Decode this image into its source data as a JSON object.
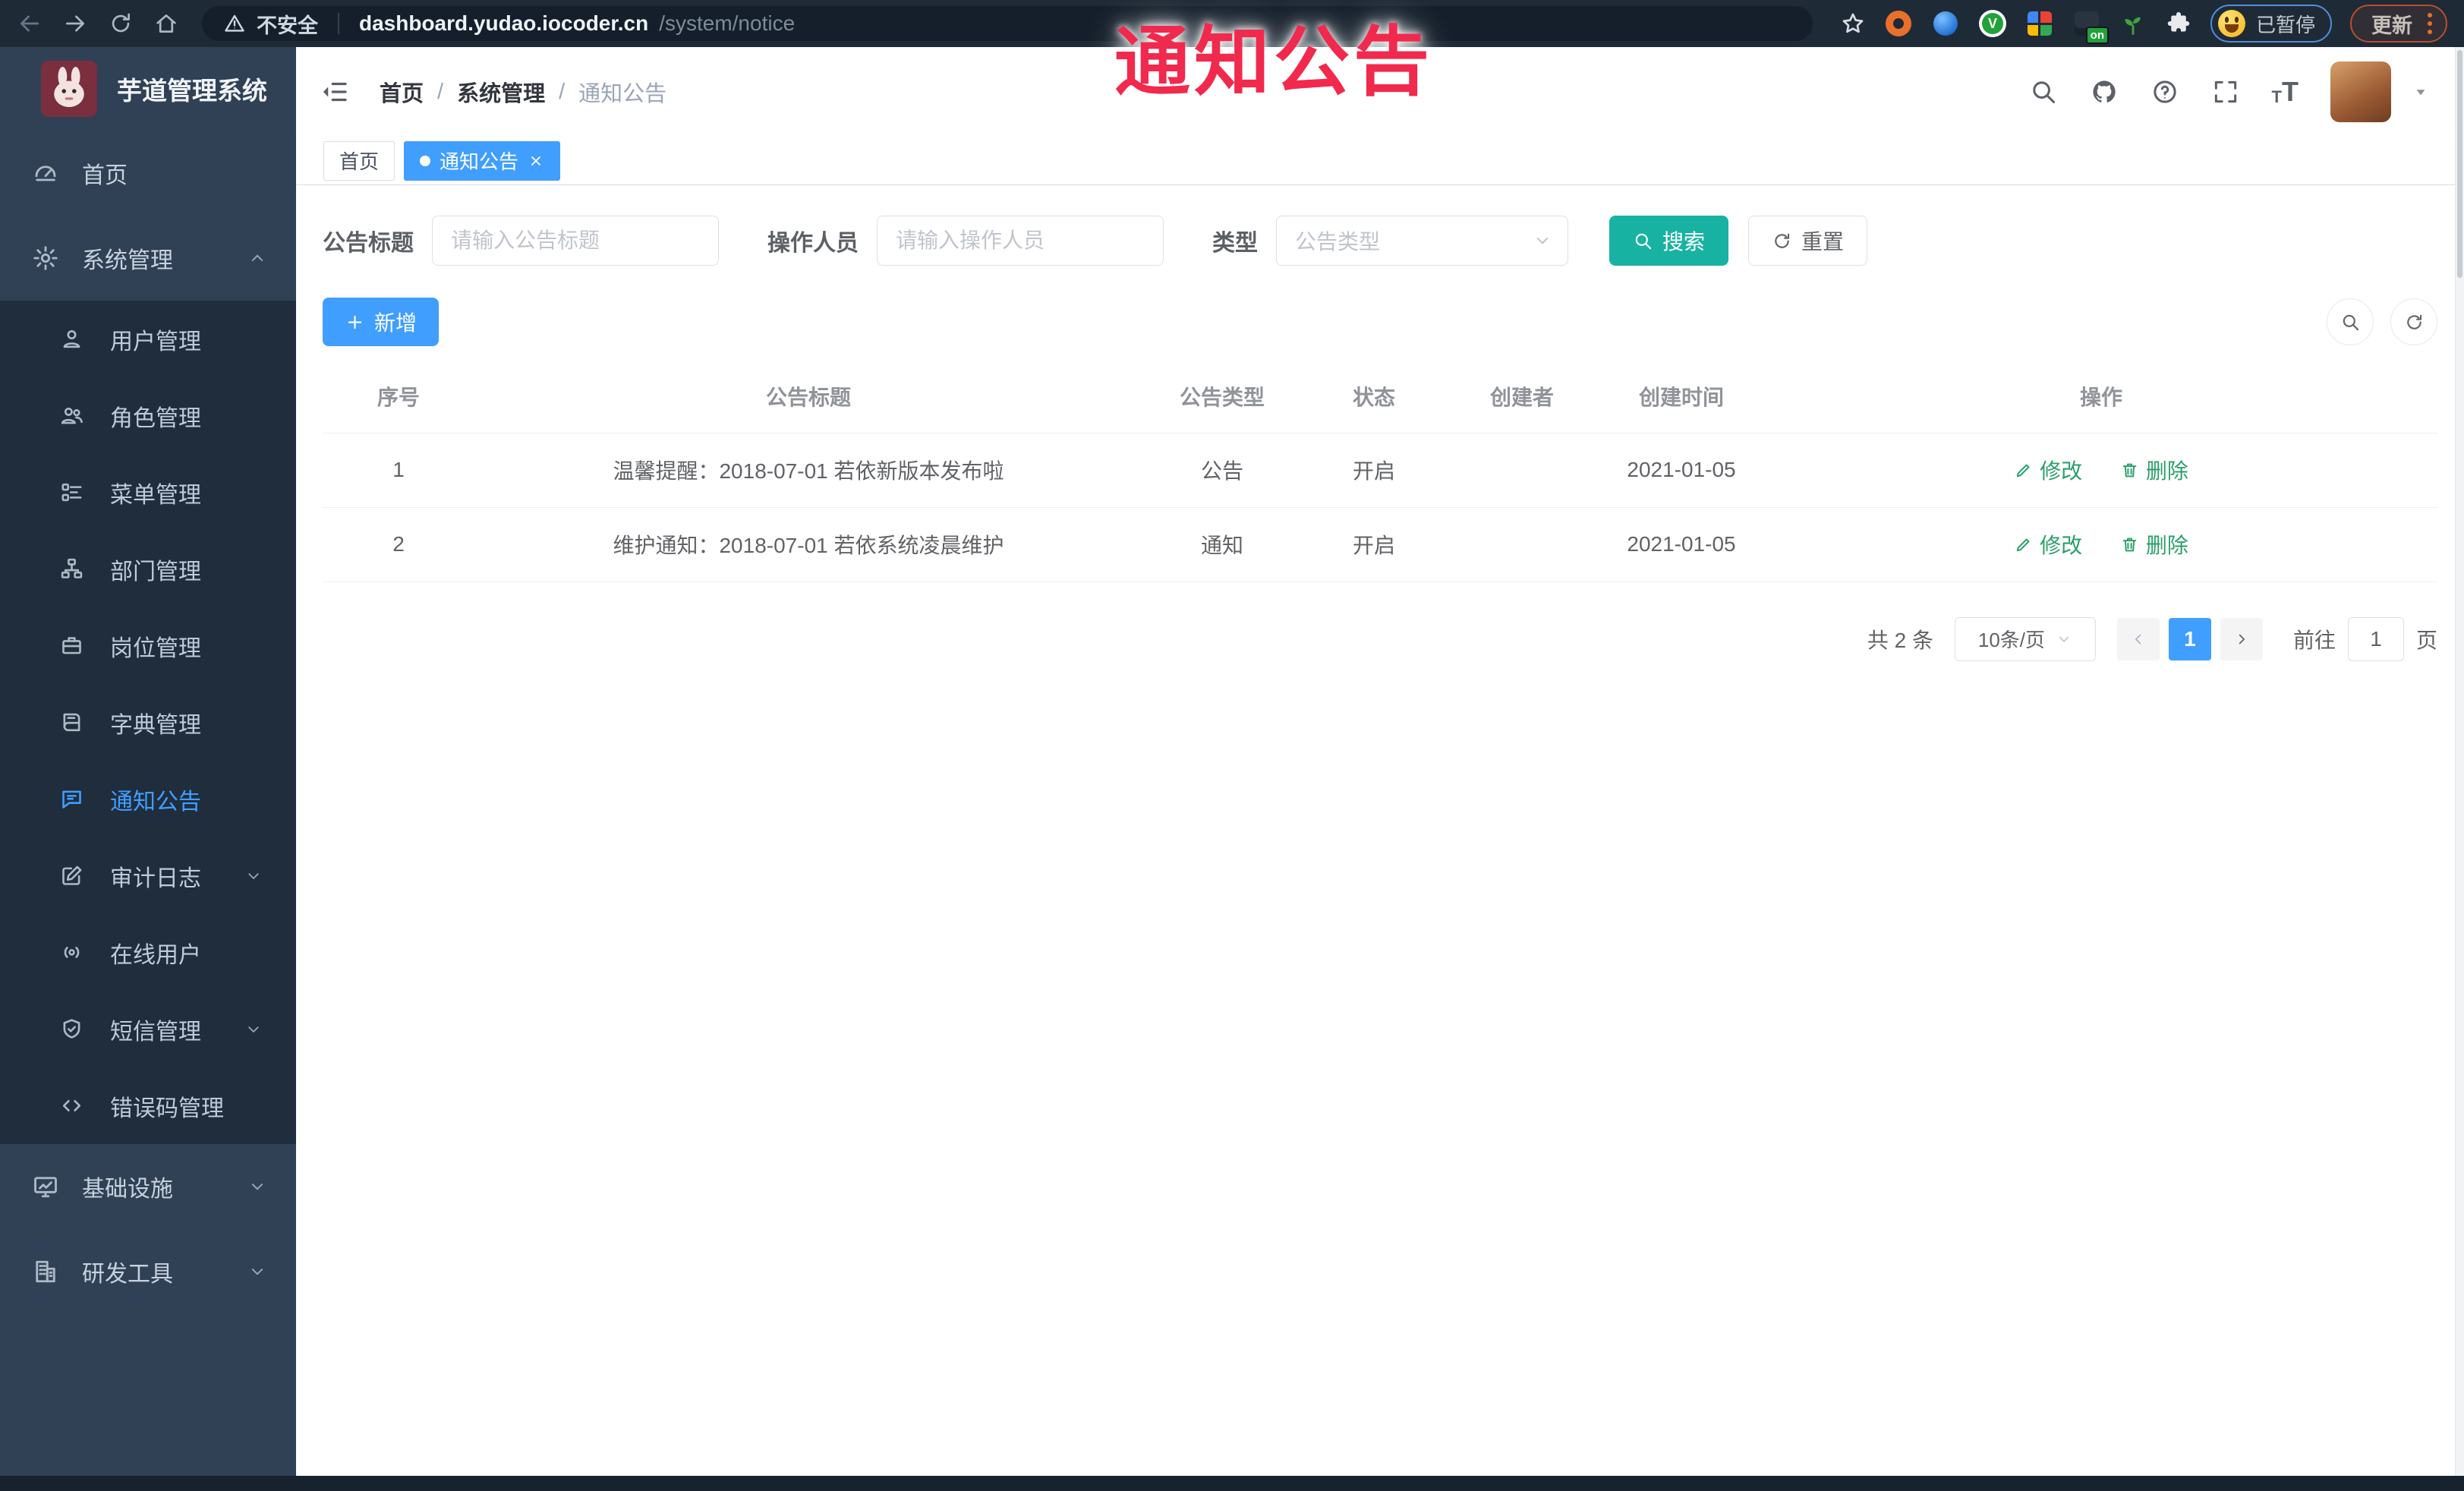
{
  "browser": {
    "security_label": "不安全",
    "url_host": "dashboard.yudao.iocoder.cn",
    "url_path": "/system/notice",
    "extension_badge": "on",
    "extension_v_glyph": "V",
    "profile_label": "已暂停",
    "update_label": "更新"
  },
  "overlay_title": "通知公告",
  "sidebar": {
    "logo_title": "芋道管理系统",
    "items_top": [
      {
        "label": "首页"
      },
      {
        "label": "系统管理"
      }
    ],
    "system_children": [
      {
        "label": "用户管理"
      },
      {
        "label": "角色管理"
      },
      {
        "label": "菜单管理"
      },
      {
        "label": "部门管理"
      },
      {
        "label": "岗位管理"
      },
      {
        "label": "字典管理"
      },
      {
        "label": "通知公告"
      },
      {
        "label": "审计日志"
      },
      {
        "label": "在线用户"
      },
      {
        "label": "短信管理"
      },
      {
        "label": "错误码管理"
      }
    ],
    "items_bottom": [
      {
        "label": "基础设施"
      },
      {
        "label": "研发工具"
      }
    ]
  },
  "header": {
    "breadcrumb": [
      "首页",
      "系统管理",
      "通知公告"
    ],
    "separator": "/",
    "font_icon_small": "T",
    "font_icon_big": "T"
  },
  "tabs": [
    {
      "label": "首页"
    },
    {
      "label": "通知公告"
    }
  ],
  "filters": {
    "title_label": "公告标题",
    "title_placeholder": "请输入公告标题",
    "operator_label": "操作人员",
    "operator_placeholder": "请输入操作人员",
    "type_label": "类型",
    "type_placeholder": "公告类型",
    "search_label": "搜索",
    "reset_label": "重置"
  },
  "toolbar": {
    "add_label": "新增"
  },
  "table": {
    "columns": [
      "序号",
      "公告标题",
      "公告类型",
      "状态",
      "创建者",
      "创建时间",
      "操作"
    ],
    "rows": [
      {
        "no": "1",
        "title": "温馨提醒：2018-07-01 若依新版本发布啦",
        "type": "公告",
        "status": "开启",
        "creator": "",
        "created": "2021-01-05",
        "edit_label": "修改",
        "delete_label": "删除"
      },
      {
        "no": "2",
        "title": "维护通知：2018-07-01 若依系统凌晨维护",
        "type": "通知",
        "status": "开启",
        "creator": "",
        "created": "2021-01-05",
        "edit_label": "修改",
        "delete_label": "删除"
      }
    ]
  },
  "pagination": {
    "total_label": "共 2 条",
    "page_size_label": "10条/页",
    "current_page": "1",
    "goto_label": "前往",
    "goto_value": "1",
    "unit_label": "页"
  },
  "colors": {
    "accent": "#409EFF",
    "search_button": "#18B2A2",
    "action_link": "#2AA06A",
    "overlay_red": "#F1294D",
    "sidebar_bg": "#304156",
    "submenu_bg": "#1F2D3D",
    "browser_bar": "#1F2A37"
  },
  "icons": {
    "back-icon": "←",
    "forward-icon": "→",
    "reload-icon": "⟳",
    "home-icon": "⌂",
    "security-warning-icon": "⚠",
    "bookmark-star-icon": "☆",
    "extensions-puzzle-icon": "puzzle",
    "browser-menu-icon": "⋮",
    "hamburger-fold-icon": "☰",
    "search-icon": "⌕",
    "github-icon": "octocat",
    "help-icon": "?",
    "fullscreen-icon": "⛶",
    "font-size-icon": "tT",
    "caret-down-icon": "▾",
    "chevron-up-icon": "∧",
    "chevron-down-icon": "∨",
    "dashboard-icon": "gauge",
    "system-gear-icon": "⚙",
    "user-icon": "person",
    "role-icon": "people",
    "menu-tree-icon": "list",
    "dept-icon": "org-tree",
    "post-icon": "briefcase",
    "dict-icon": "book",
    "notice-chat-icon": "chat-bubble",
    "audit-edit-icon": "edit-square",
    "online-broadcast-icon": "broadcast",
    "sms-shield-icon": "shield-check",
    "errcode-code-icon": "</>",
    "infra-monitor-icon": "monitor-chart",
    "devtools-building-icon": "building",
    "plus-icon": "+",
    "reset-refresh-icon": "⟳",
    "edit-pencil-icon": "✎",
    "delete-trash-icon": "🗑"
  }
}
